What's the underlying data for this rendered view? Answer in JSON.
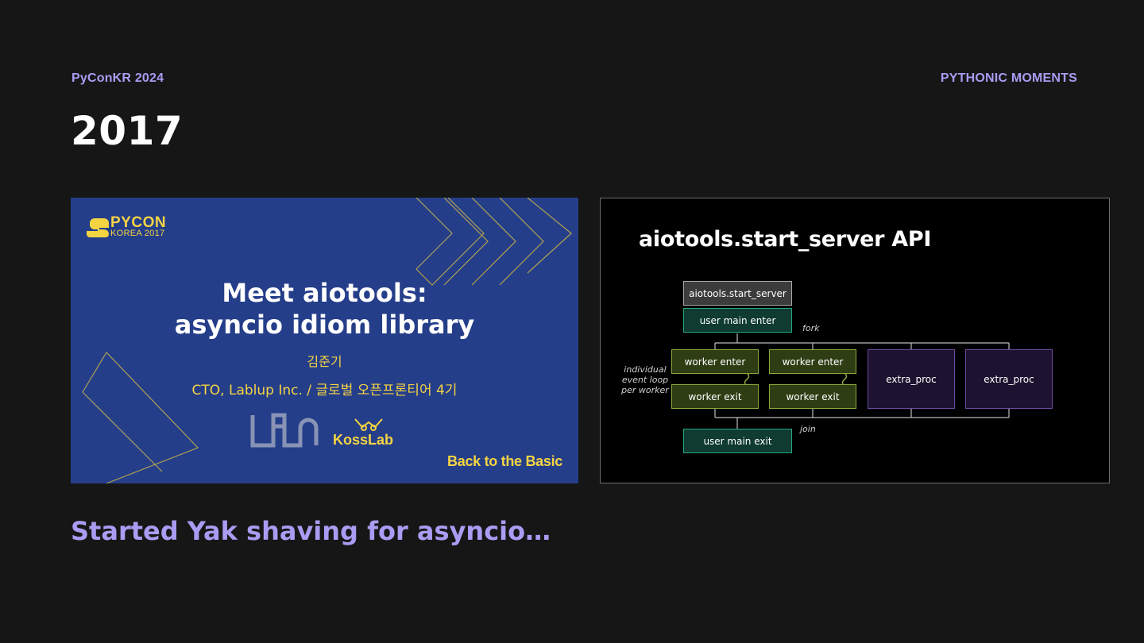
{
  "header": {
    "event": "PyConKR 2024",
    "section": "PYTHONIC MOMENTS",
    "year": "2017"
  },
  "left_slide": {
    "logo_word": "PYCON",
    "logo_sub": "KOREA 2017",
    "title_line1": "Meet aiotools:",
    "title_line2": "asyncio idiom library",
    "speaker_name": "김준기",
    "speaker_role": "CTO, Lablup Inc. / 글로벌 오픈프론티어 4기",
    "kosslab": "KossLab",
    "tagline": "Back to the Basic"
  },
  "right_slide": {
    "title": "aiotools.start_server API",
    "boxes": {
      "start_server": "aiotools.start_server",
      "user_main_enter": "user main enter",
      "worker_enter_1": "worker enter",
      "worker_enter_2": "worker enter",
      "worker_exit_1": "worker exit",
      "worker_exit_2": "worker exit",
      "extra_proc_1": "extra_proc",
      "extra_proc_2": "extra_proc",
      "user_main_exit": "user main exit"
    },
    "labels": {
      "fork": "fork",
      "join": "join",
      "side_line1": "individual",
      "side_line2": "event loop",
      "side_line3": "per worker"
    }
  },
  "caption": "Started Yak shaving for asyncio…",
  "colors": {
    "background": "#161616",
    "accent": "#a99cf2",
    "slide_blue": "#253e8a",
    "slide_yellow": "#f5d442"
  }
}
